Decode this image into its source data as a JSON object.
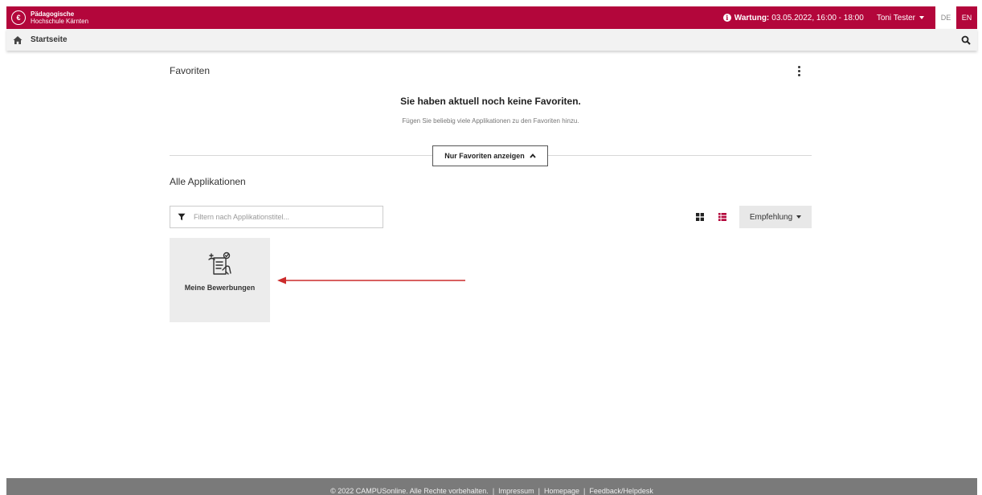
{
  "header": {
    "logo_line1": "Pädagogische",
    "logo_line2": "Hochschule Kärnten",
    "maintenance_label": "Wartung:",
    "maintenance_value": "03.05.2022, 16:00 - 18:00",
    "user_name": "Toni Tester",
    "lang_de": "DE",
    "lang_en": "EN",
    "brand_color": "#b3063b"
  },
  "breadcrumb": {
    "home_label": "Startseite"
  },
  "favorites": {
    "title": "Favoriten",
    "empty_title": "Sie haben aktuell noch keine Favoriten.",
    "empty_subtitle": "Fügen Sie beliebig viele Applikationen zu den Favoriten hinzu.",
    "toggle_label": "Nur Favoriten anzeigen"
  },
  "applications": {
    "title": "Alle Applikationen",
    "filter_placeholder": "Filtern nach Applikationstitel...",
    "sort_label": "Empfehlung",
    "tiles": [
      {
        "label": "Meine Bewerbungen",
        "icon": "application-form-icon"
      }
    ]
  },
  "footer": {
    "copyright": "© 2022 CAMPUSonline. Alle Rechte vorbehalten.",
    "links": [
      "Impressum",
      "Homepage",
      "Feedback/Helpdesk"
    ]
  }
}
